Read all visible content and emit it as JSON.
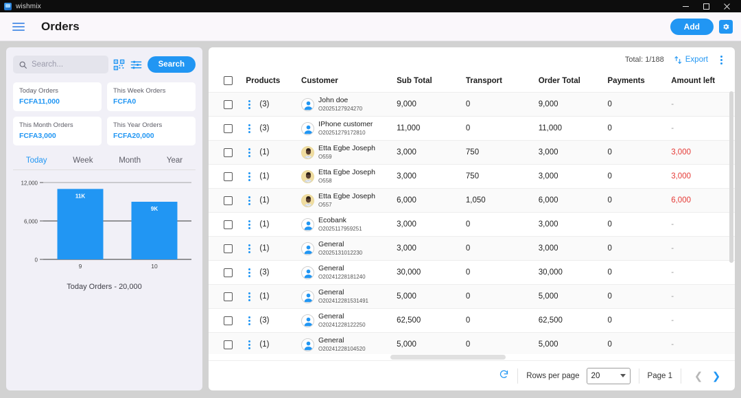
{
  "window": {
    "app_name": "wishmix",
    "minimize": "—",
    "maximize": "❐",
    "close": "✕"
  },
  "appbar": {
    "menu_icon": "hamburger-icon",
    "title": "Orders",
    "add_label": "Add",
    "settings_icon": "gear-icon"
  },
  "search": {
    "placeholder": "Search...",
    "value": "",
    "scan_icon": "qr-scan-icon",
    "filter_icon": "filter-sliders-icon",
    "button_label": "Search"
  },
  "stats": [
    {
      "label": "Today Orders",
      "value": "FCFA11,000"
    },
    {
      "label": "This Week Orders",
      "value": "FCFA0"
    },
    {
      "label": "This Month Orders",
      "value": "FCFA3,000"
    },
    {
      "label": "This Year Orders",
      "value": "FCFA20,000"
    }
  ],
  "period_tabs": [
    {
      "label": "Today",
      "active": true
    },
    {
      "label": "Week",
      "active": false
    },
    {
      "label": "Month",
      "active": false
    },
    {
      "label": "Year",
      "active": false
    }
  ],
  "chart_data": {
    "type": "bar",
    "title": "Today Orders - 20,000",
    "categories": [
      "9",
      "10"
    ],
    "values": [
      11000,
      9000
    ],
    "data_labels": [
      "11K",
      "9K"
    ],
    "ylabel": "",
    "xlabel": "",
    "ylim": [
      0,
      12000
    ],
    "yticks": [
      0,
      6000,
      12000
    ],
    "ytick_labels": [
      "0",
      "6,000",
      "12,000"
    ],
    "grid": true,
    "legend": false,
    "bar_color": "#2196f3"
  },
  "table": {
    "total_text": "Total: 1/188",
    "export_label": "Export",
    "export_icon": "export-icon",
    "more_icon": "kebab-menu-icon",
    "columns": [
      "Products",
      "Customer",
      "Sub Total",
      "Transport",
      "Order Total",
      "Payments",
      "Amount left"
    ],
    "rows": [
      {
        "products": "(3)",
        "name": "John doe",
        "id": "O2025127924270",
        "avatar": "person",
        "sub_total": "9,000",
        "transport": "0",
        "order_total": "9,000",
        "payments": "0",
        "amount_left": "-",
        "due": false
      },
      {
        "products": "(3)",
        "name": "IPhone customer",
        "id": "O20251279172810",
        "avatar": "person",
        "sub_total": "11,000",
        "transport": "0",
        "order_total": "11,000",
        "payments": "0",
        "amount_left": "-",
        "due": false
      },
      {
        "products": "(1)",
        "name": "Etta Egbe Joseph",
        "id": "O559",
        "avatar": "photo",
        "sub_total": "3,000",
        "transport": "750",
        "order_total": "3,000",
        "payments": "0",
        "amount_left": "3,000",
        "due": true
      },
      {
        "products": "(1)",
        "name": "Etta Egbe Joseph",
        "id": "O558",
        "avatar": "photo",
        "sub_total": "3,000",
        "transport": "750",
        "order_total": "3,000",
        "payments": "0",
        "amount_left": "3,000",
        "due": true
      },
      {
        "products": "(1)",
        "name": "Etta Egbe Joseph",
        "id": "O557",
        "avatar": "photo",
        "sub_total": "6,000",
        "transport": "1,050",
        "order_total": "6,000",
        "payments": "0",
        "amount_left": "6,000",
        "due": true
      },
      {
        "products": "(1)",
        "name": "Ecobank",
        "id": "O2025117959251",
        "avatar": "person",
        "sub_total": "3,000",
        "transport": "0",
        "order_total": "3,000",
        "payments": "0",
        "amount_left": "-",
        "due": false
      },
      {
        "products": "(1)",
        "name": "General",
        "id": "O2025131012230",
        "avatar": "person",
        "sub_total": "3,000",
        "transport": "0",
        "order_total": "3,000",
        "payments": "0",
        "amount_left": "-",
        "due": false
      },
      {
        "products": "(3)",
        "name": "General",
        "id": "O20241228181240",
        "avatar": "person",
        "sub_total": "30,000",
        "transport": "0",
        "order_total": "30,000",
        "payments": "0",
        "amount_left": "-",
        "due": false
      },
      {
        "products": "(1)",
        "name": "General",
        "id": "O202412281531491",
        "avatar": "person",
        "sub_total": "5,000",
        "transport": "0",
        "order_total": "5,000",
        "payments": "0",
        "amount_left": "-",
        "due": false
      },
      {
        "products": "(3)",
        "name": "General",
        "id": "O20241228122250",
        "avatar": "person",
        "sub_total": "62,500",
        "transport": "0",
        "order_total": "62,500",
        "payments": "0",
        "amount_left": "-",
        "due": false
      },
      {
        "products": "(1)",
        "name": "General",
        "id": "O20241228104520",
        "avatar": "person",
        "sub_total": "5,000",
        "transport": "0",
        "order_total": "5,000",
        "payments": "0",
        "amount_left": "-",
        "due": false
      }
    ]
  },
  "footer": {
    "refresh_icon": "refresh-icon",
    "rows_per_page_label": "Rows per page",
    "rows_per_page_value": "20",
    "page_label": "Page 1",
    "prev_icon": "chevron-left-icon",
    "next_icon": "chevron-right-icon"
  },
  "colors": {
    "accent": "#2196f3",
    "danger": "#e53935",
    "page_bg": "#d2d2d2",
    "panel_bg": "#f1f0f7"
  }
}
